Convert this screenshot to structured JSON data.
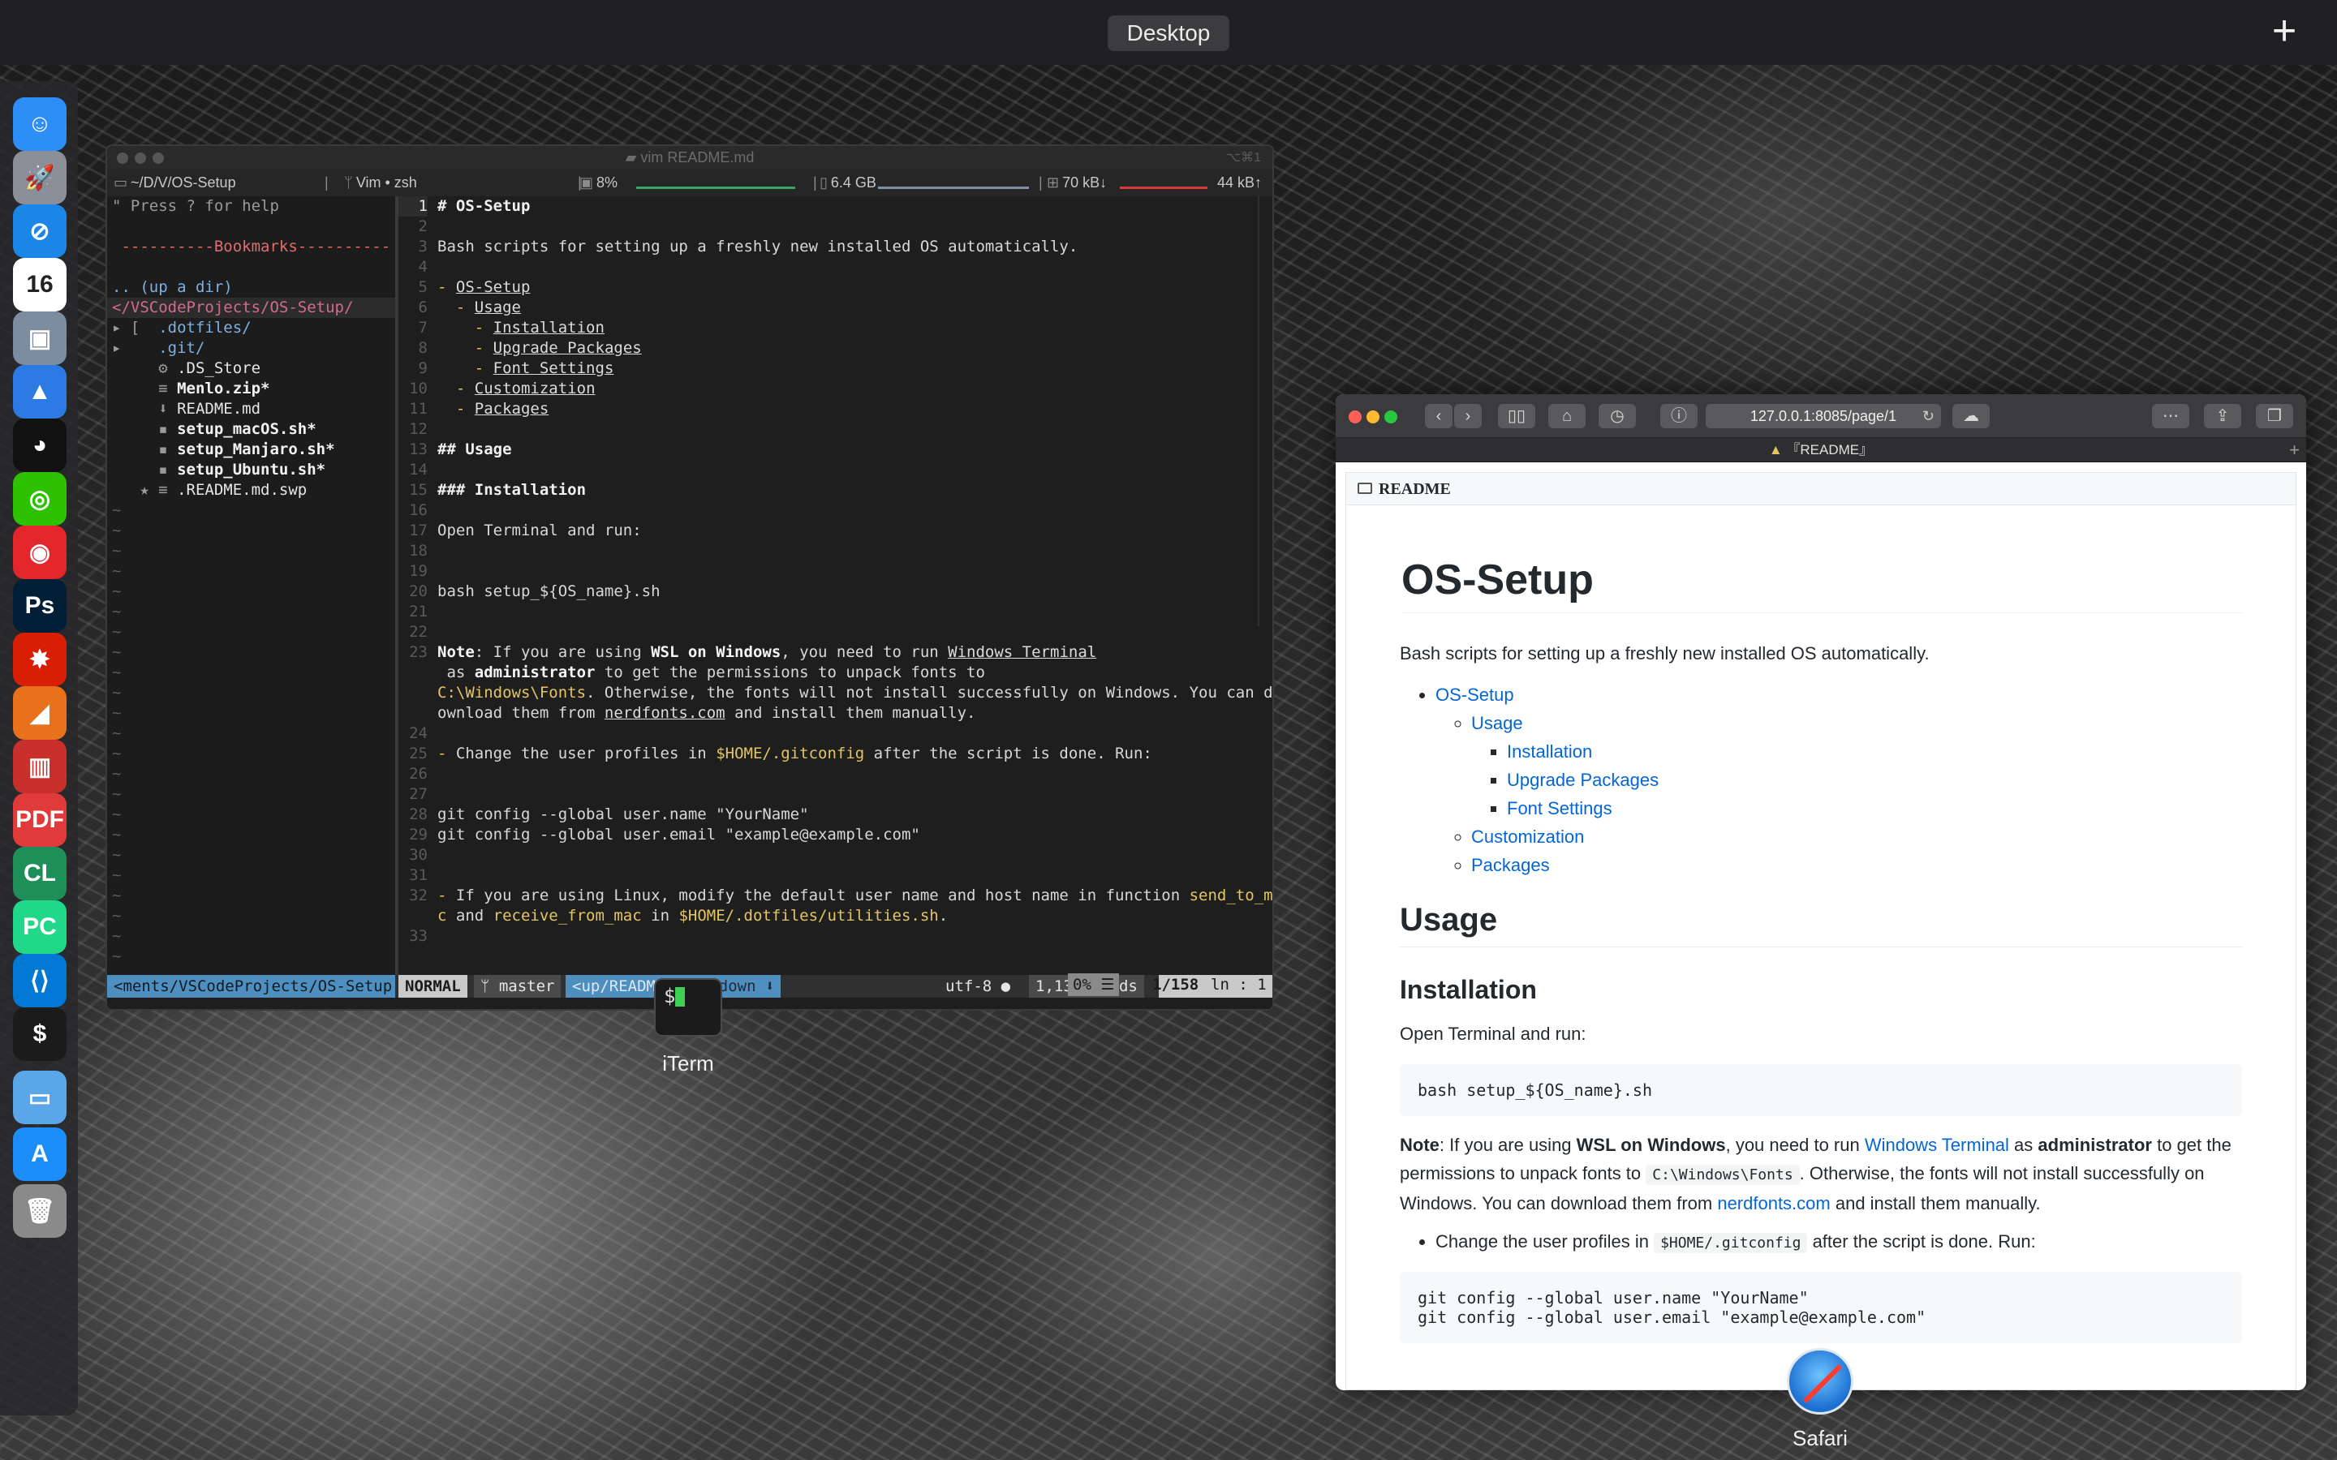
{
  "mission_control": {
    "space_label": "Desktop",
    "add_label": "+"
  },
  "dock": {
    "apps": [
      {
        "name": "Finder",
        "glyph": "☺",
        "color": "#2e8ef7"
      },
      {
        "name": "Launchpad",
        "glyph": "🚀",
        "color": "#8a8f99"
      },
      {
        "name": "Safari",
        "glyph": "⊘",
        "color": "#1a86e8"
      },
      {
        "name": "Calendar",
        "glyph": "16",
        "color": "#ffffff"
      },
      {
        "name": "Preview",
        "glyph": "▣",
        "color": "#7d8da0"
      },
      {
        "name": "Spark",
        "glyph": "▲",
        "color": "#2c7be5"
      },
      {
        "name": "QQ",
        "glyph": "◕",
        "color": "#111111"
      },
      {
        "name": "WeChat",
        "glyph": "◎",
        "color": "#2dc100"
      },
      {
        "name": "NetEase Music",
        "glyph": "◉",
        "color": "#e2262c"
      },
      {
        "name": "Photoshop",
        "glyph": "Ps",
        "color": "#001e36"
      },
      {
        "name": "Wolfram",
        "glyph": "✸",
        "color": "#d81e05"
      },
      {
        "name": "MATLAB",
        "glyph": "◢",
        "color": "#e8721c"
      },
      {
        "name": "Parallels",
        "glyph": "▥",
        "color": "#c9302c"
      },
      {
        "name": "PDF Expert",
        "glyph": "PDF",
        "color": "#e03a3a"
      },
      {
        "name": "CLion",
        "glyph": "CL",
        "color": "#1f8f5a"
      },
      {
        "name": "PyCharm",
        "glyph": "PC",
        "color": "#21d789"
      },
      {
        "name": "VS Code",
        "glyph": "⟨⟩",
        "color": "#0078d4"
      },
      {
        "name": "iTerm",
        "glyph": "$",
        "color": "#1b1b1b"
      },
      {
        "name": "Folder",
        "glyph": "▭",
        "color": "#5aa6e8"
      },
      {
        "name": "App Store",
        "glyph": "A",
        "color": "#1c8ef9"
      },
      {
        "name": "Trash",
        "glyph": "🗑",
        "color": "#8a8a8a"
      }
    ]
  },
  "iterm": {
    "window_title": "vim README.md",
    "shortcut": "⌥⌘1",
    "label": "iTerm",
    "status": {
      "path": "~/D/V/OS-Setup",
      "job": "Vim • zsh",
      "cpu": "8%",
      "memory": "6.4 GB",
      "net_down": "70 kB↓",
      "net_up": "44 kB↑"
    },
    "nerdtree": {
      "help": "\" Press ? for help",
      "bookmarks": " ----------Bookmarks----------",
      "up_dir": ".. (up a dir)",
      "root": "</VSCodeProjects/OS-Setup/",
      "entries": [
        {
          "prefix": "▸ [  ",
          "name": ".dotfiles/",
          "style": "c-blue"
        },
        {
          "prefix": "▸    ",
          "name": ".git/",
          "style": "c-blue"
        },
        {
          "prefix": "     ⚙ ",
          "name": ".DS_Store",
          "style": "c-white"
        },
        {
          "prefix": "     ≡ ",
          "name": "Menlo.zip*",
          "style": "c-bold"
        },
        {
          "prefix": "     ⬇ ",
          "name": "README.md",
          "style": "c-white"
        },
        {
          "prefix": "     ▪ ",
          "name": "setup_macOS.sh*",
          "style": "c-bold"
        },
        {
          "prefix": "     ▪ ",
          "name": "setup_Manjaro.sh*",
          "style": "c-bold"
        },
        {
          "prefix": "     ▪ ",
          "name": "setup_Ubuntu.sh*",
          "style": "c-bold"
        },
        {
          "prefix": "   ★ ≡ ",
          "name": ".README.md.swp",
          "style": "c-white"
        }
      ]
    },
    "editor_lines": [
      {
        "n": "1",
        "cur": true,
        "html": "<span class=\"md-h\"># OS-Setup</span>"
      },
      {
        "n": "2",
        "html": ""
      },
      {
        "n": "3",
        "html": "Bash scripts for setting up a freshly new installed OS automatically."
      },
      {
        "n": "4",
        "html": ""
      },
      {
        "n": "5",
        "html": "<span class=\"md-bullet\">-</span> <span class=\"md-link\">OS-Setup</span>"
      },
      {
        "n": "6",
        "html": "  <span class=\"md-bullet\">-</span> <span class=\"md-link\">Usage</span>"
      },
      {
        "n": "7",
        "html": "    <span class=\"md-bullet\">-</span> <span class=\"md-link\">Installation</span>"
      },
      {
        "n": "8",
        "html": "    <span class=\"md-bullet\">-</span> <span class=\"md-link\">Upgrade Packages</span>"
      },
      {
        "n": "9",
        "html": "    <span class=\"md-bullet\">-</span> <span class=\"md-link\">Font Settings</span>"
      },
      {
        "n": "10",
        "html": "  <span class=\"md-bullet\">-</span> <span class=\"md-link\">Customization</span>"
      },
      {
        "n": "11",
        "html": "  <span class=\"md-bullet\">-</span> <span class=\"md-link\">Packages</span>"
      },
      {
        "n": "12",
        "html": ""
      },
      {
        "n": "13",
        "html": "<span class=\"md-h\">## Usage</span>"
      },
      {
        "n": "14",
        "html": ""
      },
      {
        "n": "15",
        "html": "<span class=\"md-h\">### Installation</span>"
      },
      {
        "n": "16",
        "html": ""
      },
      {
        "n": "17",
        "html": "Open Terminal and run:"
      },
      {
        "n": "18",
        "html": ""
      },
      {
        "n": "19",
        "html": ""
      },
      {
        "n": "20",
        "html": "bash setup_${OS_name}.sh"
      },
      {
        "n": "21",
        "html": ""
      },
      {
        "n": "22",
        "html": ""
      },
      {
        "n": "23",
        "html": "<span class=\"md-bold\">Note</span>: If you are using <span class=\"md-bold\">WSL on Windows</span>, you need to run <span class=\"md-link\">Windows Terminal</span>"
      },
      {
        "n": "",
        "html": " as <span class=\"md-bold\">administrator</span> to get the permissions to unpack fonts to"
      },
      {
        "n": "",
        "html": "<span class=\"md-code\">C:\\Windows\\Fonts</span>. Otherwise, the fonts will not install successfully on Windows. You can d"
      },
      {
        "n": "",
        "html": "ownload them from <span class=\"md-link\">nerdfonts.com</span> and install them manually."
      },
      {
        "n": "24",
        "html": ""
      },
      {
        "n": "25",
        "html": "<span class=\"md-bullet\">-</span> Change the user profiles in <span class=\"md-code\">$HOME/.gitconfig</span> after the script is done. Run:"
      },
      {
        "n": "26",
        "html": ""
      },
      {
        "n": "27",
        "html": ""
      },
      {
        "n": "28",
        "html": "git config --global user.name \"YourName\""
      },
      {
        "n": "29",
        "html": "git config --global user.email \"example@example.com\""
      },
      {
        "n": "30",
        "html": ""
      },
      {
        "n": "31",
        "html": ""
      },
      {
        "n": "32",
        "html": "<span class=\"md-bullet\">-</span> If you are using Linux, modify the default user name and host name in function <span class=\"md-code\">send_to_ma</span>"
      },
      {
        "n": "",
        "html": "<span class=\"md-code\">c</span> and <span class=\"md-code\">receive_from_mac</span> in <span class=\"md-code\">$HOME/.dotfiles/utilities.sh</span>."
      },
      {
        "n": "33",
        "html": ""
      }
    ],
    "airline": {
      "nt_path": "<ments/VSCodeProjects/OS-Setup",
      "mode": "NORMAL",
      "branch": "master",
      "file": "<up/README",
      "filetype": "markdown",
      "encoding": "utf-8",
      "words": "1,136 words",
      "percent": "0% ☰",
      "position": "1/158",
      "col": "ln :  1"
    }
  },
  "safari": {
    "url": "127.0.0.1:8085/page/1",
    "tab_title": "『README』",
    "label": "Safari",
    "readme_label": "README",
    "doc": {
      "h1": "OS-Setup",
      "intro": "Bash scripts for setting up a freshly new installed OS automatically.",
      "toc": {
        "root": "OS-Setup",
        "usage": "Usage",
        "usage_children": [
          "Installation",
          "Upgrade Packages",
          "Font Settings"
        ],
        "customization": "Customization",
        "packages": "Packages"
      },
      "h2_usage": "Usage",
      "h3_install": "Installation",
      "open_terminal": "Open Terminal and run:",
      "install_cmd": "bash setup_${OS_name}.sh",
      "note": {
        "label": "Note",
        "t1": ": If you are using ",
        "wsl": "WSL on Windows",
        "t2": ", you need to run ",
        "terminal": "Windows Terminal",
        "t3": " as ",
        "admin": "administrator",
        "t4": " to get the permissions to unpack fonts to ",
        "fonts_path": "C:\\Windows\\Fonts",
        "t5": ". Otherwise, the fonts will not install successfully on Windows. You can download them from ",
        "nerdfonts": "nerdfonts.com",
        "t6": " and install them manually."
      },
      "gitconfig": {
        "t1": "Change the user profiles in ",
        "path": "$HOME/.gitconfig",
        "t2": " after the script is done. Run:"
      },
      "git_cmd_1": "git config --global user.name \"YourName\"",
      "git_cmd_2": "git config --global user.email \"example@example.com\""
    }
  }
}
